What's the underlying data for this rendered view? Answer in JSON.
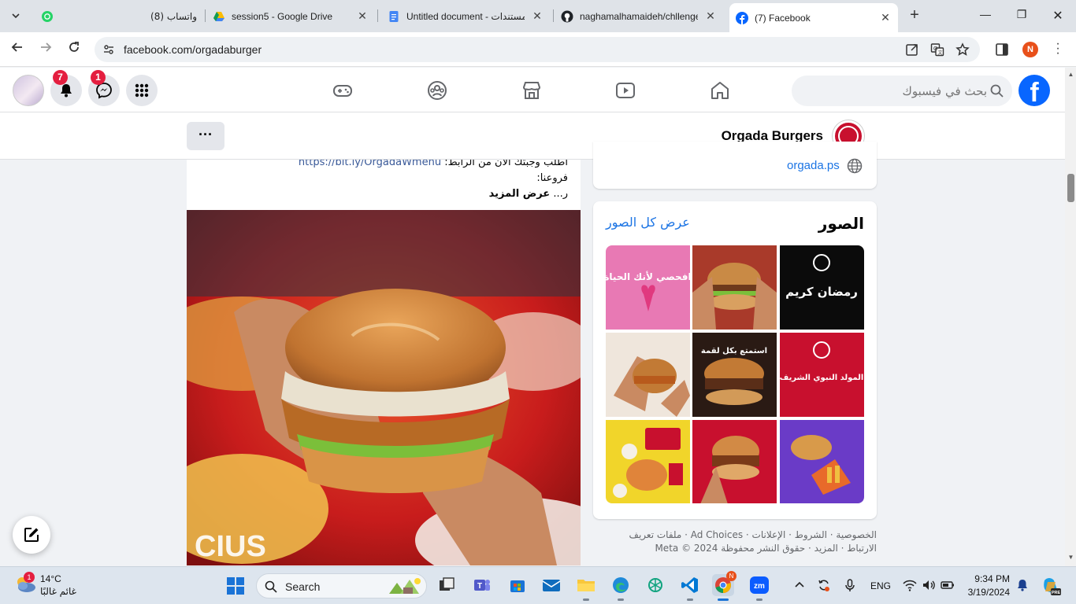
{
  "browser": {
    "tabs": [
      {
        "title": "واتساب (8)",
        "icon": "whatsapp-icon"
      },
      {
        "title": "session5 - Google Drive",
        "icon": "google-drive-icon"
      },
      {
        "title": "Untitled document - مستندات",
        "icon": "google-docs-icon"
      },
      {
        "title": "naghamalhamaideh/chllenge",
        "icon": "github-icon"
      },
      {
        "title": "(7) Facebook",
        "icon": "facebook-icon"
      }
    ],
    "url": "facebook.com/orgadaburger",
    "profile_initial": "N"
  },
  "fb_nav": {
    "notifications_count": "7",
    "messenger_count": "1",
    "search_placeholder": "بحث في فيسبوك"
  },
  "page": {
    "name": "Orgada Burgers",
    "more_label": "···"
  },
  "post": {
    "line1_text": "اطلب وجبتك الآن من الرابط: ",
    "line1_link": "https://bit.ly/OrgadaWmenu",
    "line2": "فروعنا:",
    "line3_prefix": "ر...",
    "see_more": "عرض المزيد"
  },
  "intro": {
    "website": "orgada.ps"
  },
  "photos": {
    "title": "الصور",
    "see_all": "عرض كل الصور",
    "items": [
      {
        "caption": "رمضان كريم"
      },
      {
        "caption": ""
      },
      {
        "caption": "افحصي لأنك الحياة"
      },
      {
        "caption": "المولد النبوي الشريف"
      },
      {
        "caption": "استمتع بكل لقمة"
      },
      {
        "caption": ""
      },
      {
        "caption": ""
      },
      {
        "caption": ""
      },
      {
        "caption": ""
      }
    ]
  },
  "footer": {
    "line1": "الخصوصية · الشروط · الإعلانات · Ad Choices · ملفات تعريف",
    "line2": "الارتباط · المزيد · حقوق النشر محفوظة Meta © 2024"
  },
  "taskbar": {
    "weather_badge": "1",
    "temperature": "14°C",
    "weather_desc": "غائم غالبًا",
    "search_label": "Search",
    "language": "ENG",
    "time": "9:34 PM",
    "date": "3/19/2024"
  },
  "colors": {
    "facebook_blue": "#0866ff",
    "link_blue": "#1b74e4",
    "badge_red": "#e41e3f",
    "brand_red": "#c8102e"
  }
}
